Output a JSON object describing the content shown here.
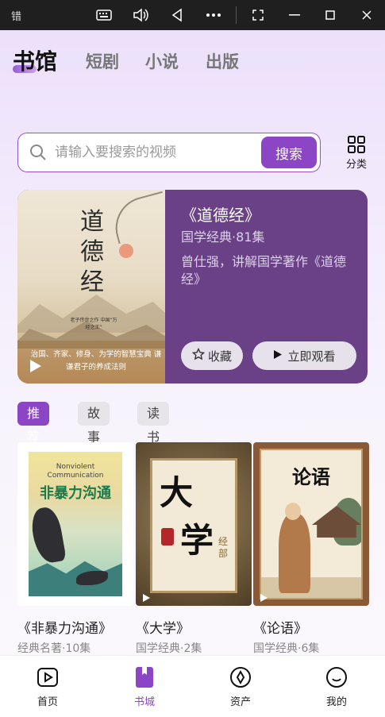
{
  "window": {
    "title": "错",
    "controls": [
      "keyboard-icon",
      "volume-icon",
      "back-icon",
      "more-icon",
      "screenshot-icon",
      "minimize-icon",
      "maximize-icon",
      "close-icon"
    ]
  },
  "top_tabs": [
    {
      "label": "书馆",
      "active": true
    },
    {
      "label": "短剧",
      "active": false
    },
    {
      "label": "小说",
      "active": false
    },
    {
      "label": "出版",
      "active": false
    }
  ],
  "search": {
    "placeholder": "请输入要搜索的视频",
    "button_label": "搜索",
    "category_label": "分类"
  },
  "featured": {
    "cover_title": "道德经",
    "cover_subtitle": "老子传世之作 中国“万经之王”",
    "cover_tagline": "治国、齐家、修身、为学的智慧宝典 谦谦君子的养成法则",
    "title": "《道德经》",
    "meta": "国学经典·81集",
    "description": "曾仕强，讲解国学著作《道德经》",
    "fav_label": "收藏",
    "watch_label": "立即观看"
  },
  "chips": [
    {
      "label": "推荐",
      "active": true
    },
    {
      "label": "故事",
      "active": false
    },
    {
      "label": "读书",
      "active": false
    }
  ],
  "books": [
    {
      "title": "《非暴力沟通》",
      "meta": "经典名著·10集",
      "cover_en": "Nonviolent Communication",
      "cover_cn": "非暴力沟通"
    },
    {
      "title": "《大学》",
      "meta": "国学经典·2集",
      "cover_big1": "大",
      "cover_big2": "学",
      "cover_side": "经部"
    },
    {
      "title": "《论语》",
      "meta": "国学经典·6集",
      "cover_title": "论语"
    }
  ],
  "bottom_nav": [
    {
      "label": "首页",
      "icon": "play-square-icon",
      "active": false
    },
    {
      "label": "书城",
      "icon": "bookmark-book-icon",
      "active": true
    },
    {
      "label": "资产",
      "icon": "compass-icon",
      "active": false
    },
    {
      "label": "我的",
      "icon": "smile-icon",
      "active": false
    }
  ],
  "colors": {
    "accent": "#8c45c4",
    "feature_bg": "#6a4186",
    "titlebar": "#1f1f1f"
  }
}
